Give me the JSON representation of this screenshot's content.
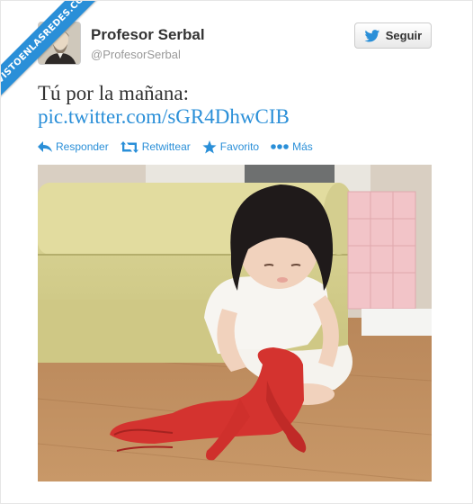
{
  "watermark": {
    "text": "VISTOENLASREDES.COM"
  },
  "profile": {
    "name": "Profesor Serbal",
    "handle": "@ProfesorSerbal"
  },
  "follow_button": {
    "label": "Seguir",
    "icon": "twitter-bird-icon"
  },
  "tweet": {
    "text": "Tú por la mañana:",
    "link": "pic.twitter.com/sGR4DhwCIB"
  },
  "actions": [
    {
      "label": "Responder",
      "icon": "reply-icon"
    },
    {
      "label": "Retwittear",
      "icon": "retweet-icon"
    },
    {
      "label": "Favorito",
      "icon": "star-icon"
    },
    {
      "label": "Más",
      "icon": "more-icon"
    }
  ],
  "colors": {
    "link": "#2a8fd8",
    "text": "#333333",
    "muted": "#999999",
    "ribbon": "#2a8fd8"
  }
}
